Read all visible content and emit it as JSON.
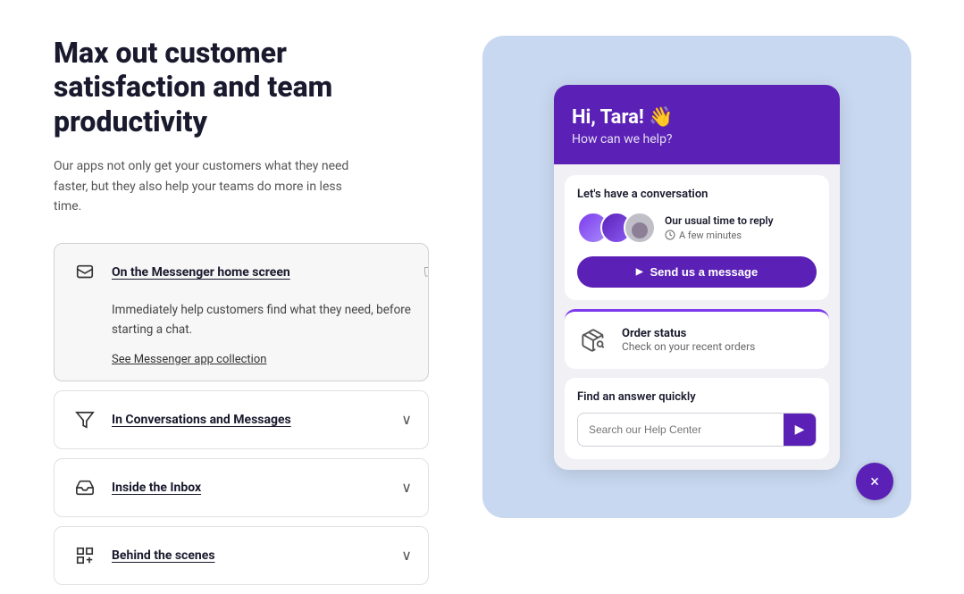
{
  "left": {
    "heading": "Max out customer satisfaction and team productivity",
    "subtext": "Our apps not only get your customers what they need faster, but they also help your teams do more in less time.",
    "accordion": [
      {
        "id": "messenger",
        "title": "On the Messenger home screen",
        "icon": "messenger-icon",
        "active": true,
        "content": "Immediately help customers find what they need, before starting a chat.",
        "link": "See Messenger app collection"
      },
      {
        "id": "conversations",
        "title": "In Conversations and Messages",
        "icon": "conversations-icon",
        "active": false,
        "content": "",
        "link": ""
      },
      {
        "id": "inbox",
        "title": "Inside the Inbox",
        "icon": "inbox-icon",
        "active": false,
        "content": "",
        "link": ""
      },
      {
        "id": "behind",
        "title": "Behind the scenes",
        "icon": "grid-icon",
        "active": false,
        "content": "",
        "link": ""
      }
    ]
  },
  "right": {
    "header": {
      "greeting": "Hi, Tara! 👋",
      "subgreeting": "How can we help?"
    },
    "chat_card": {
      "title": "Let's have a conversation",
      "reply_label": "Our usual time to reply",
      "reply_time": "A few minutes",
      "send_button": "Send us a message"
    },
    "order_card": {
      "title": "Order status",
      "subtitle": "Check on your recent orders"
    },
    "search_card": {
      "title": "Find an answer quickly",
      "placeholder": "Search our Help Center"
    },
    "close_button": "×"
  }
}
